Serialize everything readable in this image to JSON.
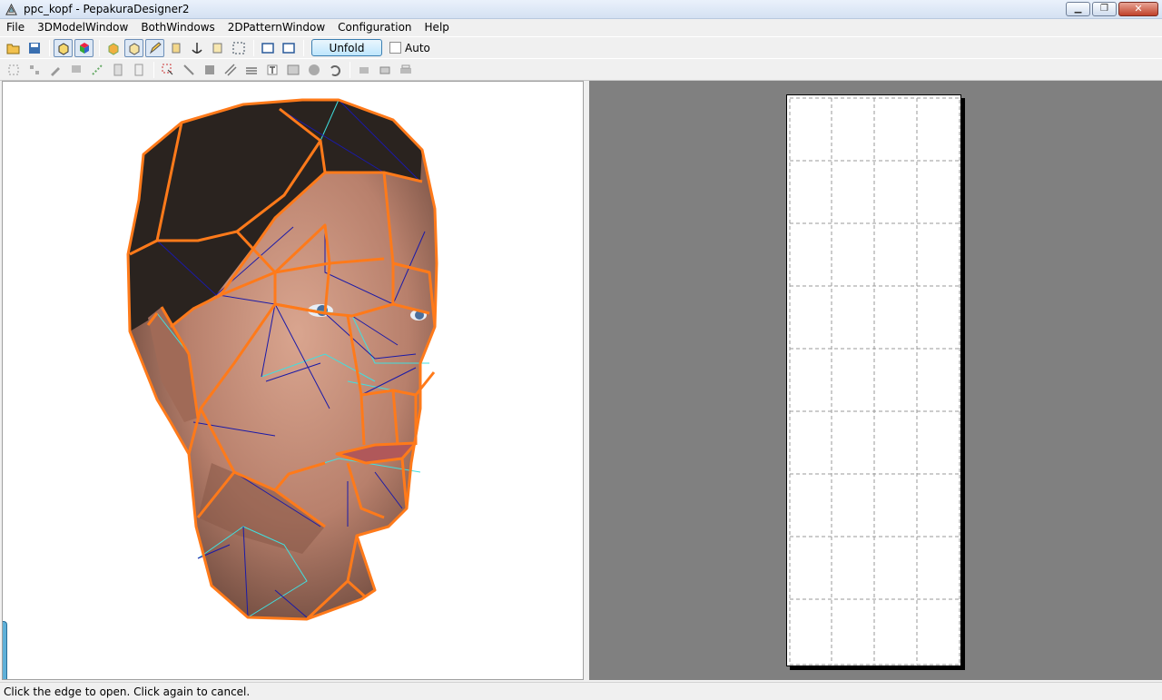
{
  "window": {
    "title": "ppc_kopf - PepakuraDesigner2",
    "controls": [
      "minimize-icon",
      "maximize-icon",
      "close-icon"
    ]
  },
  "menu": [
    "File",
    "3DModelWindow",
    "BothWindows",
    "2DPatternWindow",
    "Configuration",
    "Help"
  ],
  "toolbar1": {
    "unfold_label": "Unfold",
    "auto_label": "Auto",
    "auto_checked": false
  },
  "status": {
    "text": "Click the edge to open. Click again to cancel."
  },
  "colors": {
    "cut_edge": "#ff7a1a",
    "mountain_fold": "#1a1aa8",
    "valley_fold": "#3fe0e0",
    "pattern_bg": "#808080"
  }
}
